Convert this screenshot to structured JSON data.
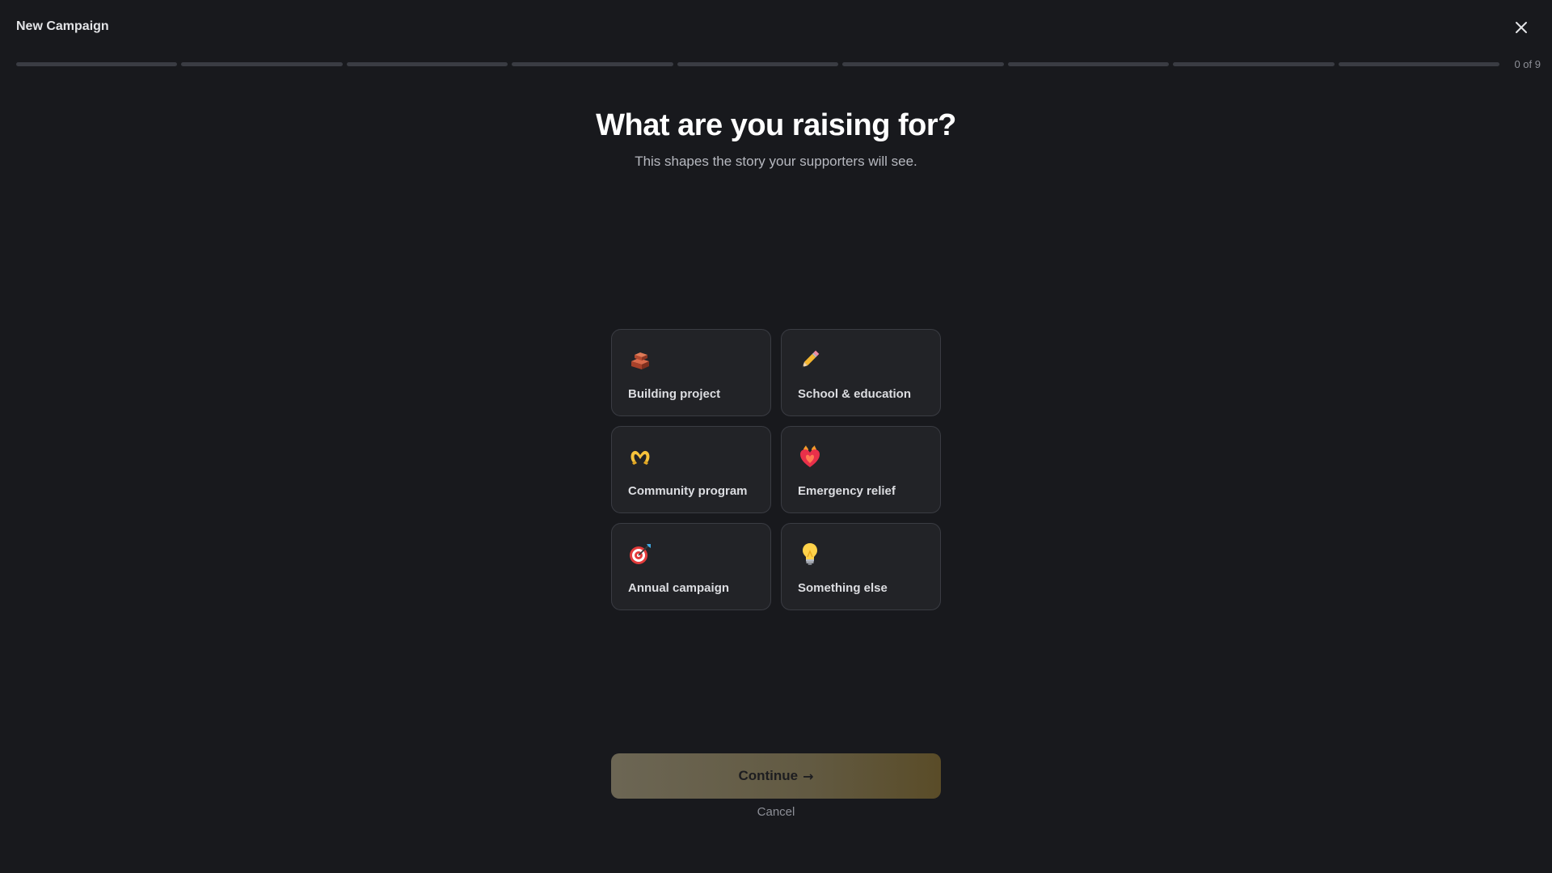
{
  "window": {
    "title": "New Campaign"
  },
  "progress": {
    "current": 0,
    "total": 9,
    "label": "0 of 9",
    "accent": "#b69a55",
    "track": "#3a3c43"
  },
  "header": {
    "title": "What are you raising for?",
    "subtitle": "This shapes the story your supporters will see."
  },
  "options": [
    {
      "label": "Building project",
      "icon": "bricks-icon"
    },
    {
      "label": "School & education",
      "icon": "pencil-icon"
    },
    {
      "label": "Community program",
      "icon": "heart-hands-icon"
    },
    {
      "label": "Emergency relief",
      "icon": "heart-on-fire-icon"
    },
    {
      "label": "Annual campaign",
      "icon": "target-dart-icon"
    },
    {
      "label": "Something else",
      "icon": "lightbulb-icon"
    }
  ],
  "footer": {
    "continue_label": "Continue",
    "continue_arrow": "→",
    "cancel_label": "Cancel"
  }
}
